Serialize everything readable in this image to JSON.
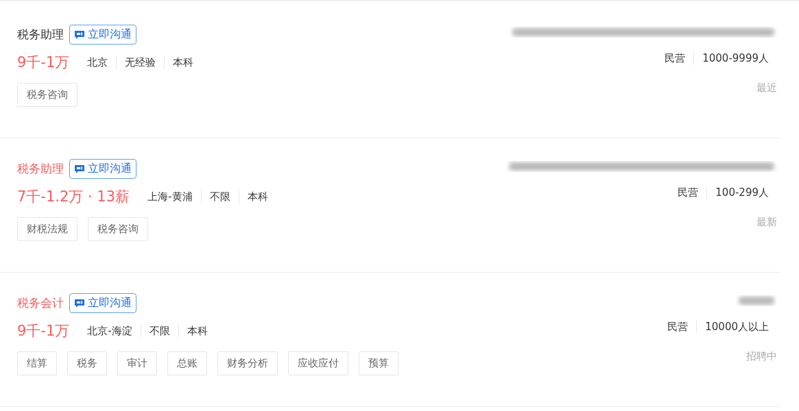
{
  "jobs": [
    {
      "title": "税务助理",
      "highlighted": false,
      "chat_badge": "立即沟通",
      "salary": "9千-1万",
      "info": [
        "北京",
        "无经验",
        "本科"
      ],
      "tags": [
        "税务咨询"
      ],
      "company_type": "民营",
      "company_size": "1000-9999人",
      "status": "最近"
    },
    {
      "title": "税务助理",
      "highlighted": true,
      "chat_badge": "立即沟通",
      "salary": "7千-1.2万 · 13薪",
      "info": [
        "上海-黄浦",
        "不限",
        "本科"
      ],
      "tags": [
        "财税法规",
        "税务咨询"
      ],
      "company_type": "民营",
      "company_size": "100-299人",
      "status": "最新"
    },
    {
      "title": "税务会计",
      "highlighted": true,
      "chat_badge": "立即沟通",
      "salary": "9千-1万",
      "info": [
        "北京-海淀",
        "不限",
        "本科"
      ],
      "tags": [
        "结算",
        "税务",
        "审计",
        "总账",
        "财务分析",
        "应收应付",
        "预算"
      ],
      "company_type": "民营",
      "company_size": "10000人以上",
      "status": "招聘中"
    }
  ]
}
